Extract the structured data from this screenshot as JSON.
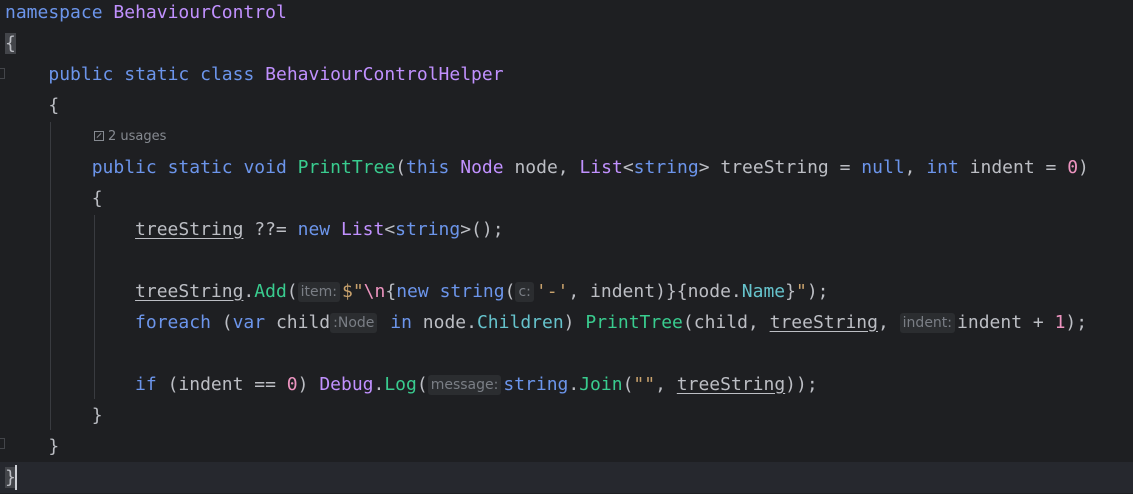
{
  "editor": {
    "code_vision": {
      "usages_label": "2 usages"
    },
    "lines": [
      {
        "tokens": [
          [
            "kw2",
            "namespace"
          ],
          [
            "ident",
            " "
          ],
          [
            "ns",
            "BehaviourControl"
          ]
        ]
      },
      {
        "tokens": [
          [
            "brace-hl",
            "{"
          ]
        ]
      },
      {
        "tokens": [
          [
            "ident",
            "    "
          ],
          [
            "kw2",
            "public"
          ],
          [
            "ident",
            " "
          ],
          [
            "kw2",
            "static"
          ],
          [
            "ident",
            " "
          ],
          [
            "kw2",
            "class"
          ],
          [
            "ident",
            " "
          ],
          [
            "type",
            "BehaviourControlHelper"
          ]
        ]
      },
      {
        "tokens": [
          [
            "ident",
            "    {"
          ]
        ]
      },
      {
        "tokens": []
      },
      {
        "tokens": [
          [
            "ident",
            "        "
          ],
          [
            "kw2",
            "public"
          ],
          [
            "ident",
            " "
          ],
          [
            "kw2",
            "static"
          ],
          [
            "ident",
            " "
          ],
          [
            "kw2",
            "void"
          ],
          [
            "ident",
            " "
          ],
          [
            "method",
            "PrintTree"
          ],
          [
            "ident",
            "("
          ],
          [
            "kw2",
            "this"
          ],
          [
            "ident",
            " "
          ],
          [
            "type",
            "Node"
          ],
          [
            "ident",
            " node, "
          ],
          [
            "type",
            "List"
          ],
          [
            "ident",
            "<"
          ],
          [
            "kw2",
            "string"
          ],
          [
            "ident",
            "> treeString = "
          ],
          [
            "kw2",
            "null"
          ],
          [
            "ident",
            ", "
          ],
          [
            "kw2",
            "int"
          ],
          [
            "ident",
            " indent = "
          ],
          [
            "num",
            "0"
          ],
          [
            "ident",
            ")"
          ]
        ]
      },
      {
        "tokens": [
          [
            "ident",
            "        {"
          ]
        ]
      },
      {
        "tokens": [
          [
            "ident",
            "            "
          ],
          [
            "ident ul",
            "treeString"
          ],
          [
            "ident",
            " ??= "
          ],
          [
            "kw2",
            "new"
          ],
          [
            "ident",
            " "
          ],
          [
            "type",
            "List"
          ],
          [
            "ident",
            "<"
          ],
          [
            "kw2",
            "string"
          ],
          [
            "ident",
            ">();"
          ]
        ]
      },
      {
        "tokens": []
      },
      {
        "tokens": [
          [
            "ident",
            "            "
          ],
          [
            "ident ul",
            "treeString"
          ],
          [
            "ident",
            "."
          ],
          [
            "method",
            "Add"
          ],
          [
            "ident",
            "("
          ],
          [
            "hint",
            "item:"
          ],
          [
            "str",
            "$\""
          ],
          [
            "esc",
            "\\n"
          ],
          [
            "ident",
            "{"
          ],
          [
            "kw2",
            "new"
          ],
          [
            "ident",
            " "
          ],
          [
            "kw2",
            "string"
          ],
          [
            "ident",
            "("
          ],
          [
            "hint",
            "c:"
          ],
          [
            "str",
            "'-'"
          ],
          [
            "ident",
            ", indent)}{node."
          ],
          [
            "prop",
            "Name"
          ],
          [
            "ident",
            "}"
          ],
          [
            "str",
            "\""
          ],
          [
            "ident",
            ");"
          ]
        ]
      },
      {
        "tokens": [
          [
            "ident",
            "            "
          ],
          [
            "kw2",
            "foreach"
          ],
          [
            "ident",
            " ("
          ],
          [
            "kw2",
            "var"
          ],
          [
            "ident",
            " child"
          ],
          [
            "hint",
            ":Node"
          ],
          [
            "ident",
            " "
          ],
          [
            "kw2",
            "in"
          ],
          [
            "ident",
            " node."
          ],
          [
            "prop",
            "Children"
          ],
          [
            "ident",
            ") "
          ],
          [
            "method",
            "PrintTree"
          ],
          [
            "ident",
            "(child, "
          ],
          [
            "ident ul",
            "treeString"
          ],
          [
            "ident",
            ", "
          ],
          [
            "hint",
            "indent:"
          ],
          [
            "ident",
            "indent + "
          ],
          [
            "num",
            "1"
          ],
          [
            "ident",
            ");"
          ]
        ]
      },
      {
        "tokens": []
      },
      {
        "tokens": [
          [
            "ident",
            "            "
          ],
          [
            "kw2",
            "if"
          ],
          [
            "ident",
            " (indent == "
          ],
          [
            "num",
            "0"
          ],
          [
            "ident",
            ") "
          ],
          [
            "type",
            "Debug"
          ],
          [
            "ident",
            "."
          ],
          [
            "method",
            "Log"
          ],
          [
            "ident",
            "("
          ],
          [
            "hint",
            "message:"
          ],
          [
            "kw2",
            "string"
          ],
          [
            "ident",
            "."
          ],
          [
            "method",
            "Join"
          ],
          [
            "ident",
            "("
          ],
          [
            "str",
            "\"\""
          ],
          [
            "ident",
            ", "
          ],
          [
            "ident ul",
            "treeString"
          ],
          [
            "ident",
            "));"
          ]
        ]
      },
      {
        "tokens": [
          [
            "ident",
            "        }"
          ]
        ]
      },
      {
        "tokens": [
          [
            "ident",
            "    }"
          ]
        ]
      },
      {
        "tokens": [
          [
            "brace-hl",
            "}"
          ]
        ]
      }
    ]
  }
}
